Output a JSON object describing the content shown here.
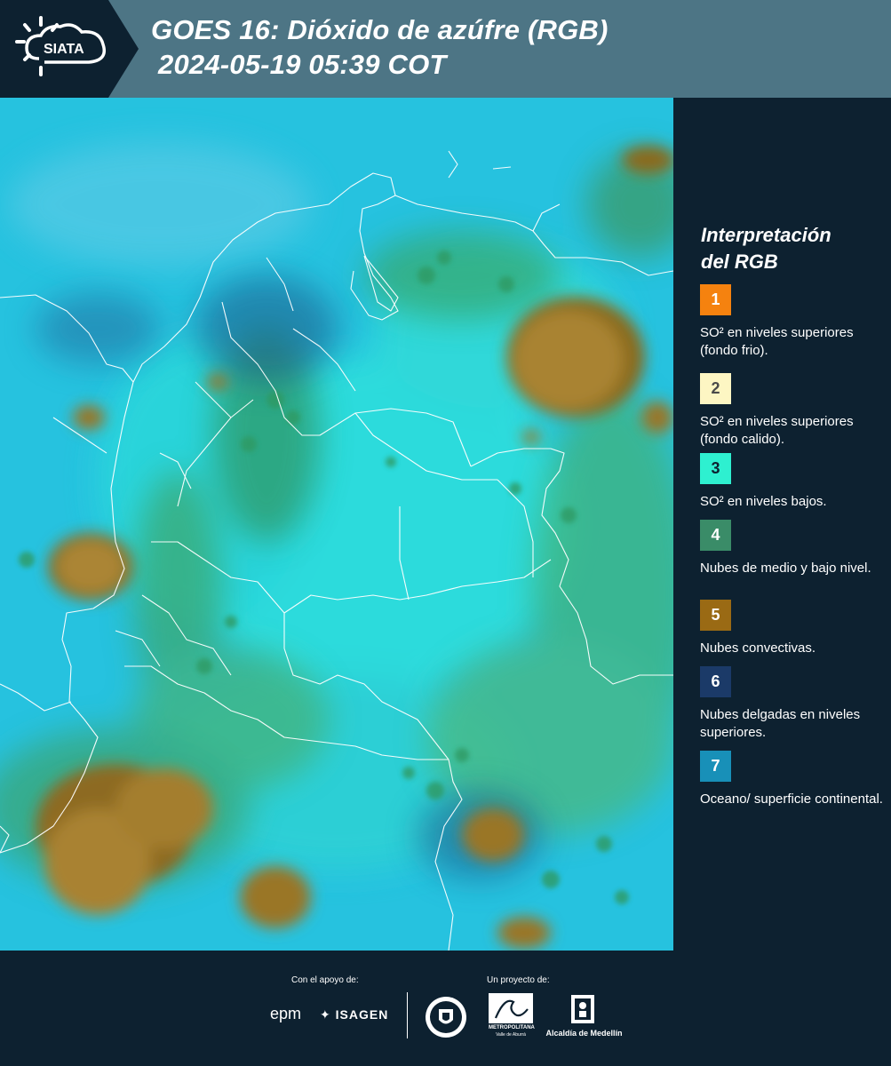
{
  "header": {
    "logo_text": "SIATA",
    "title_line1": "GOES 16: Dióxido de azúfre (RGB)",
    "title_line2": "2024-05-19 05:39 COT"
  },
  "legend": {
    "title_line1": "Interpretación",
    "title_line2": "del RGB",
    "items": [
      {
        "number": "1",
        "color": "#f5820f",
        "text_color": "#ffffff",
        "label": "SO² en niveles superiores (fondo frio)."
      },
      {
        "number": "2",
        "color": "#fdf6c3",
        "text_color": "#4a4a4a",
        "label": "SO² en niveles superiores (fondo calido)."
      },
      {
        "number": "3",
        "color": "#2ef0d0",
        "text_color": "#0d2130",
        "label": "SO² en niveles bajos."
      },
      {
        "number": "4",
        "color": "#3a8c68",
        "text_color": "#ffffff",
        "label": "Nubes de medio y bajo nivel."
      },
      {
        "number": "5",
        "color": "#9a6a14",
        "text_color": "#ffffff",
        "label": "Nubes convectivas."
      },
      {
        "number": "6",
        "color": "#1b3a68",
        "text_color": "#ffffff",
        "label": "Nubes delgadas en niveles superiores."
      },
      {
        "number": "7",
        "color": "#1890b8",
        "text_color": "#ffffff",
        "label": "Oceano/ superficie continental."
      }
    ]
  },
  "footer": {
    "support_label": "Con el apoyo de:",
    "project_label": "Un proyecto de:",
    "sponsor_epm": "epm",
    "sponsor_isagen": "ISAGEN",
    "area_label": "METROPOLITANA",
    "area_sub": "Valle de Aburrá",
    "alcaldia_label": "Alcaldía de Medellín"
  }
}
